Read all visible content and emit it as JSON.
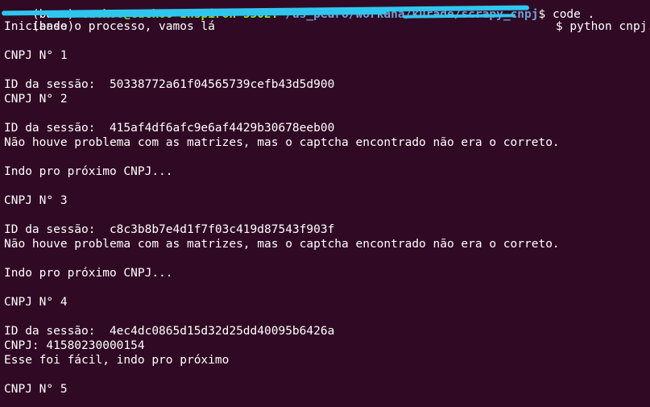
{
  "terminal": {
    "prompt_top": {
      "env": "(base)",
      "user_host": "cuckoo@cuckoo-Inspiron-5502:",
      "path": "~/ds_pedro/workana/kurade/scrapy_cnpj",
      "symbol": "$",
      "command": "code ."
    },
    "prompt_current": {
      "env": "(base)",
      "symbol": "$",
      "command": "python cnpj.py"
    },
    "output": [
      "Iniciando o processo, vamos lá",
      "",
      "CNPJ N° 1",
      "",
      "ID da sessão:  50338772a61f04565739cefb43d5d900",
      "CNPJ N° 2",
      "",
      "ID da sessão:  415af4df6afc9e6af4429b30678eeb00",
      "Não houve problema com as matrizes, mas o captcha encontrado não era o correto.",
      "",
      "Indo pro próximo CNPJ...",
      "",
      "CNPJ N° 3",
      "",
      "ID da sessão:  c8c3b8b7e4d1f7f03c419d87543f903f",
      "Não houve problema com as matrizes, mas o captcha encontrado não era o correto.",
      "",
      "Indo pro próximo CNPJ...",
      "",
      "CNPJ N° 4",
      "",
      "ID da sessão:  4ec4dc0865d15d32d25dd40095b6426a",
      "CNPJ: 41580230000154",
      "Esse foi fácil, indo pro próximo",
      "",
      "CNPJ N° 5"
    ],
    "colors": {
      "background": "#300a24",
      "text": "#ffffff",
      "user_host": "#8ae234",
      "path": "#729fcf",
      "redaction": "#2fc6ee"
    }
  }
}
